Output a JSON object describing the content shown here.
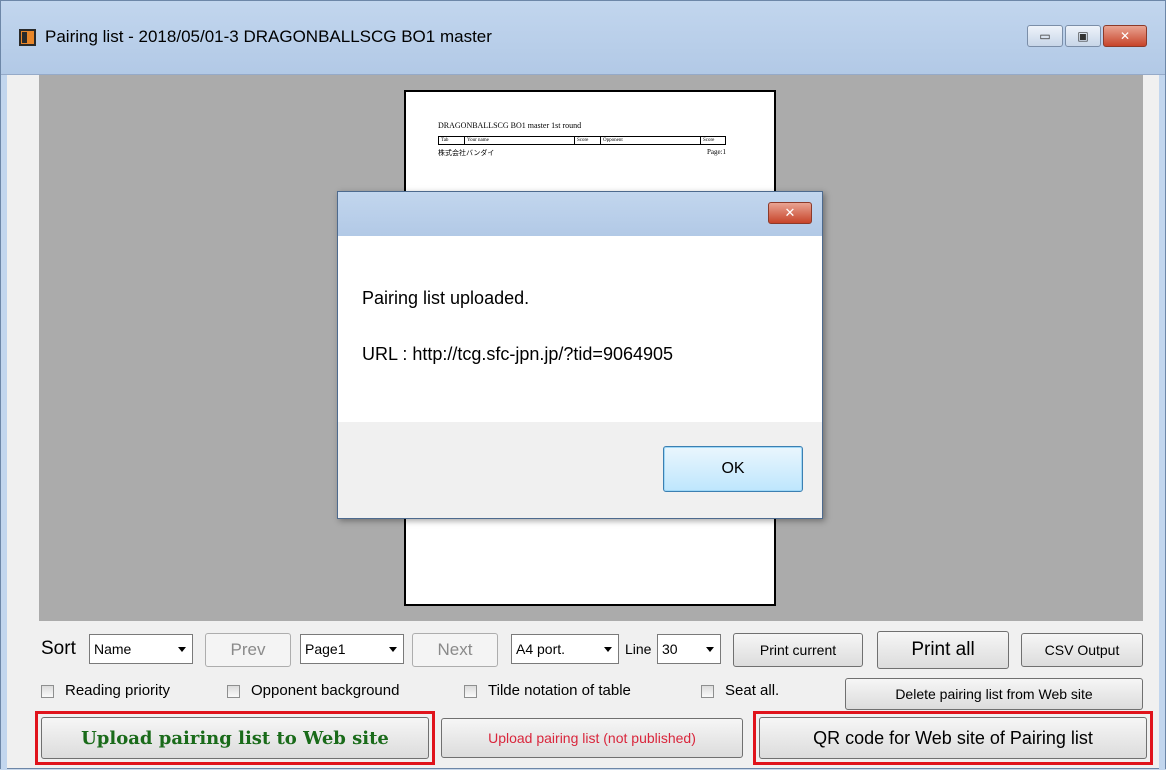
{
  "window": {
    "title": "Pairing list - 2018/05/01-3 DRAGONBALLSCG BO1 master",
    "minimize": "▭",
    "maximize": "▣",
    "close": "✕"
  },
  "preview": {
    "paper_title": "DRAGONBALLSCG BO1 master   1st round",
    "table_headers": [
      "Tab",
      "Your name",
      "Score",
      "Opponent",
      "Score"
    ],
    "footer_left": "株式会社バンダイ",
    "footer_right": "Page:1"
  },
  "dialog": {
    "close": "✕",
    "message": "Pairing list uploaded.",
    "url_line": "URL : http://tcg.sfc-jpn.jp/?tid=9064905",
    "ok_label": "OK"
  },
  "toolbar": {
    "sort_label": "Sort",
    "sort_value": "Name",
    "prev_label": "Prev",
    "page_value": "Page1",
    "next_label": "Next",
    "paper_value": "A4 port.",
    "line_label": "Line",
    "line_value": "30",
    "print_current_label": "Print current",
    "print_all_label": "Print all",
    "csv_label": "CSV Output"
  },
  "options": {
    "reading_priority": "Reading priority",
    "opponent_background": "Opponent background",
    "tilde_notation": "Tilde notation of table",
    "seat_all": "Seat all.",
    "delete_label": "Delete pairing list from Web site"
  },
  "actions": {
    "upload_label": "Upload pairing list to Web site",
    "upload_unpublished_label": "Upload pairing list (not published)",
    "qr_label": "QR code for Web site of Pairing list"
  },
  "colors": {
    "upload_text": "#1a6b1a",
    "unpublished_text": "#d9263c",
    "highlight": "#e0131b"
  }
}
